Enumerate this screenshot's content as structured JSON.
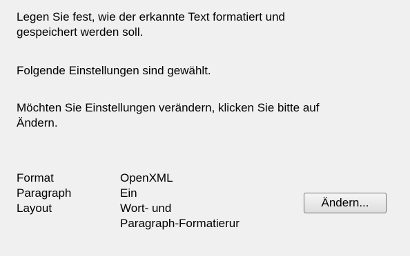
{
  "intro": {
    "description": "Legen Sie fest, wie der erkannte Text formatiert und\ngespeichert werden soll.",
    "selected_note": "Folgende Einstellungen sind gewählt.",
    "change_hint": "Möchten Sie Einstellungen verändern, klicken Sie bitte auf\nÄndern."
  },
  "settings": {
    "rows": [
      {
        "label": "Format",
        "value": "OpenXML"
      },
      {
        "label": "Paragraph",
        "value": "Ein"
      },
      {
        "label": "Layout",
        "value": "Wort- und\nParagraph-Formatierur"
      }
    ]
  },
  "buttons": {
    "change_label": "Ändern..."
  }
}
